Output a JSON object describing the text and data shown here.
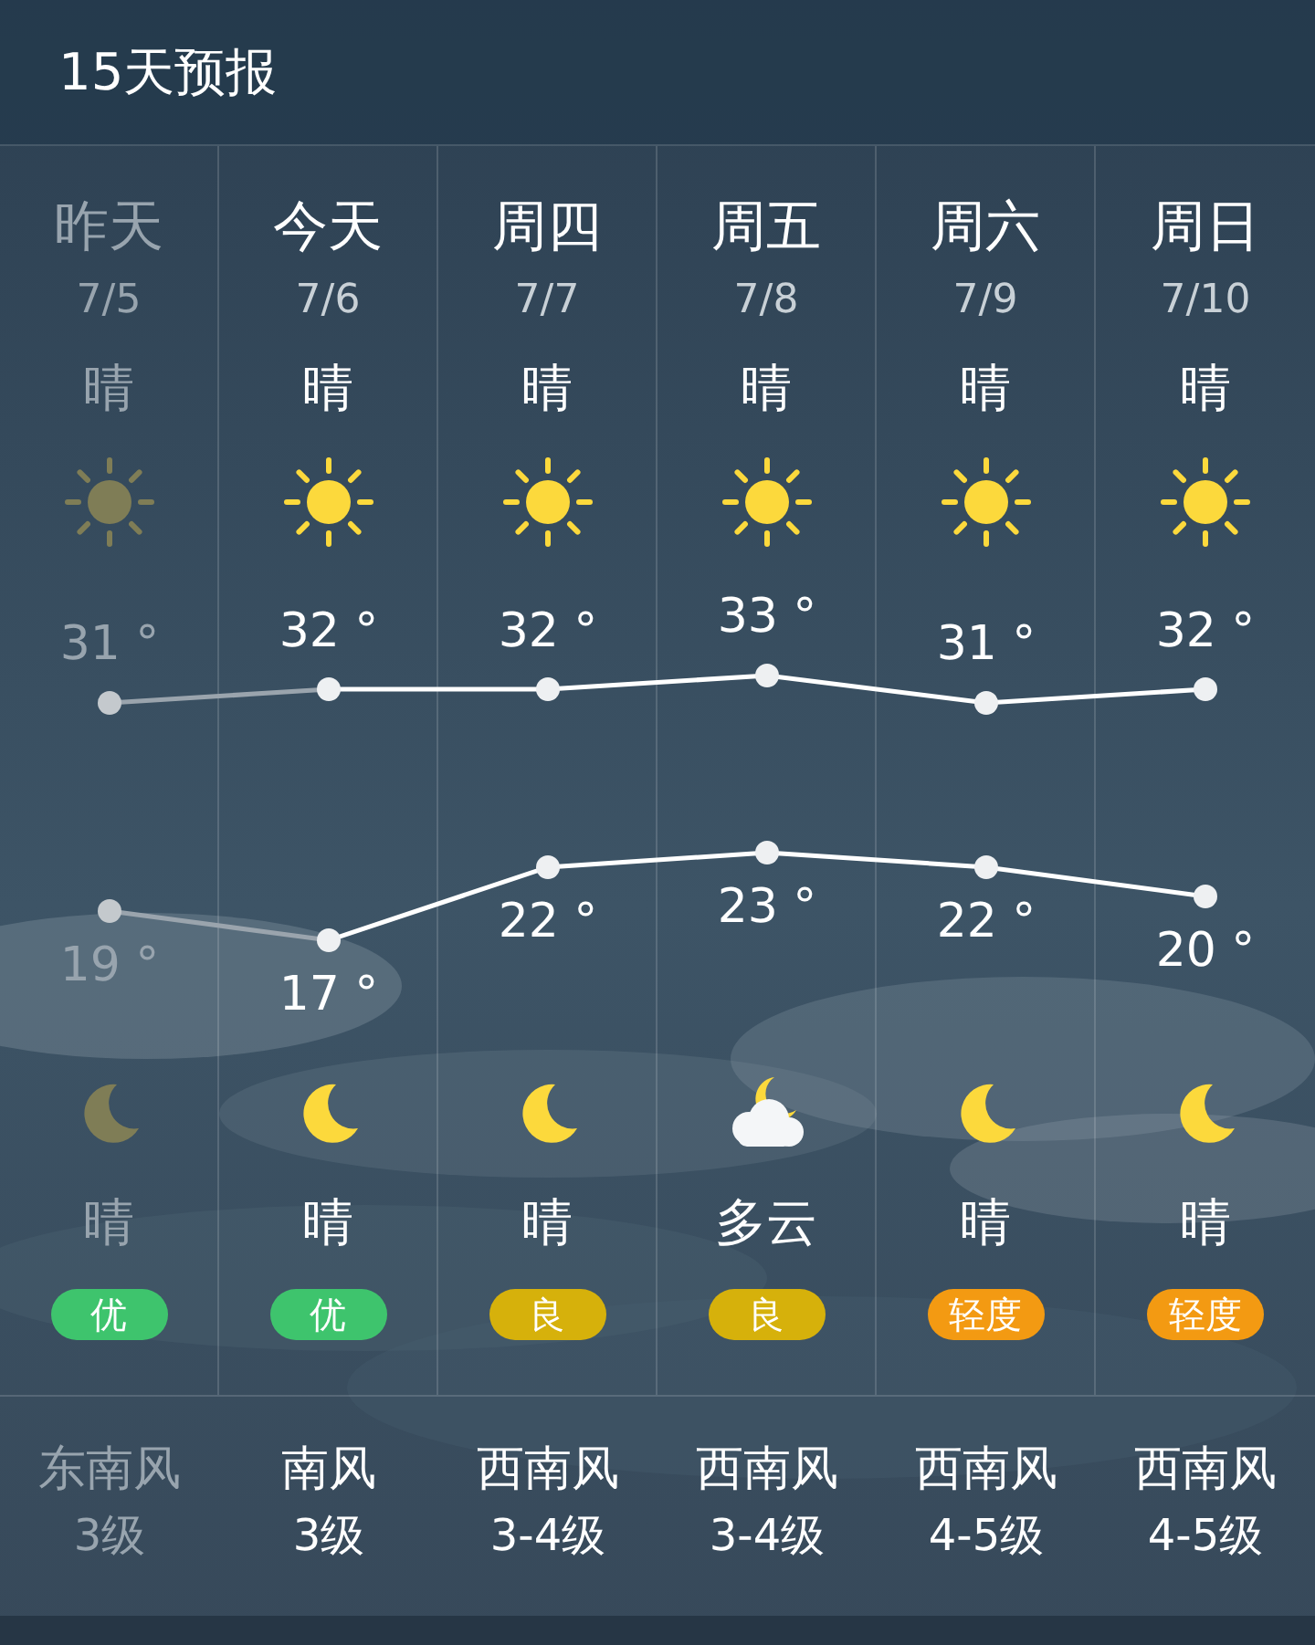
{
  "header": {
    "title": "15天预报"
  },
  "days": [
    {
      "name": "昨天",
      "date": "7/5",
      "day_weather": "晴",
      "day_icon": {
        "kind": "sun"
      },
      "high": "31 °",
      "low": "19 °",
      "night_icon": {
        "kind": "moon"
      },
      "night_weather": "晴",
      "aqi": {
        "label": "优",
        "color": "#3ec46d"
      },
      "wind": "东南风",
      "wind_level": "3级",
      "past": true
    },
    {
      "name": "今天",
      "date": "7/6",
      "day_weather": "晴",
      "day_icon": {
        "kind": "sun"
      },
      "high": "32 °",
      "low": "17 °",
      "night_icon": {
        "kind": "moon"
      },
      "night_weather": "晴",
      "aqi": {
        "label": "优",
        "color": "#3ec46d"
      },
      "wind": "南风",
      "wind_level": "3级",
      "past": false
    },
    {
      "name": "周四",
      "date": "7/7",
      "day_weather": "晴",
      "day_icon": {
        "kind": "sun"
      },
      "high": "32 °",
      "low": "22 °",
      "night_icon": {
        "kind": "moon"
      },
      "night_weather": "晴",
      "aqi": {
        "label": "良",
        "color": "#d6b10b"
      },
      "wind": "西南风",
      "wind_level": "3-4级",
      "past": false
    },
    {
      "name": "周五",
      "date": "7/8",
      "day_weather": "晴",
      "day_icon": {
        "kind": "sun"
      },
      "high": "33 °",
      "low": "23 °",
      "night_icon": {
        "kind": "cloudy_moon"
      },
      "night_weather": "多云",
      "aqi": {
        "label": "良",
        "color": "#d6b10b"
      },
      "wind": "西南风",
      "wind_level": "3-4级",
      "past": false
    },
    {
      "name": "周六",
      "date": "7/9",
      "day_weather": "晴",
      "day_icon": {
        "kind": "sun"
      },
      "high": "31 °",
      "low": "22 °",
      "night_icon": {
        "kind": "moon"
      },
      "night_weather": "晴",
      "aqi": {
        "label": "轻度",
        "color": "#f39a12"
      },
      "wind": "西南风",
      "wind_level": "4-5级",
      "past": false
    },
    {
      "name": "周日",
      "date": "7/10",
      "day_weather": "晴",
      "day_icon": {
        "kind": "sun"
      },
      "high": "32 °",
      "low": "20 °",
      "night_icon": {
        "kind": "moon"
      },
      "night_weather": "晴",
      "aqi": {
        "label": "轻度",
        "color": "#f39a12"
      },
      "wind": "西南风",
      "wind_level": "4-5级",
      "past": false
    }
  ]
}
